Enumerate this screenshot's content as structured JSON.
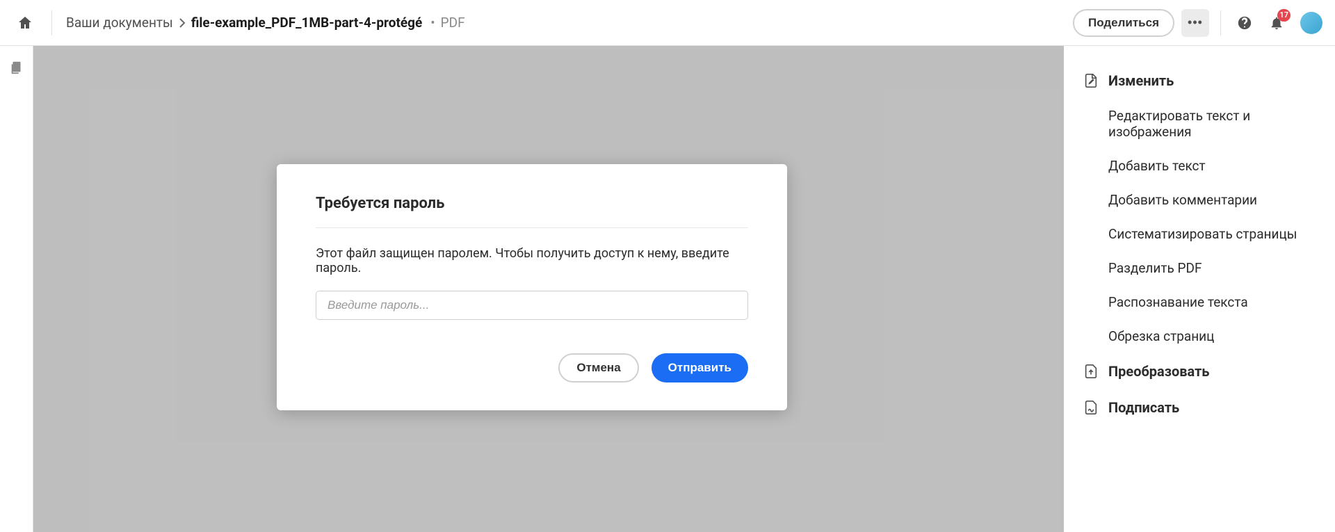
{
  "breadcrumb": {
    "root": "Ваши документы",
    "current": "file-example_PDF_1MB-part-4-protégé",
    "bullet": "•",
    "file_type": "PDF"
  },
  "header": {
    "share_label": "Поделиться",
    "notif_count": "17"
  },
  "modal": {
    "title": "Требуется пароль",
    "body": "Этот файл защищен паролем. Чтобы получить доступ к нему, введите пароль.",
    "placeholder": "Введите пароль...",
    "cancel_label": "Отмена",
    "submit_label": "Отправить"
  },
  "right_panel": {
    "edit_header": "Изменить",
    "items": [
      "Редактировать текст и изображения",
      "Добавить текст",
      "Добавить комментарии",
      "Систематизировать страницы",
      "Разделить PDF",
      "Распознавание текста",
      "Обрезка страниц"
    ],
    "convert_header": "Преобразовать",
    "sign_header": "Подписать"
  }
}
